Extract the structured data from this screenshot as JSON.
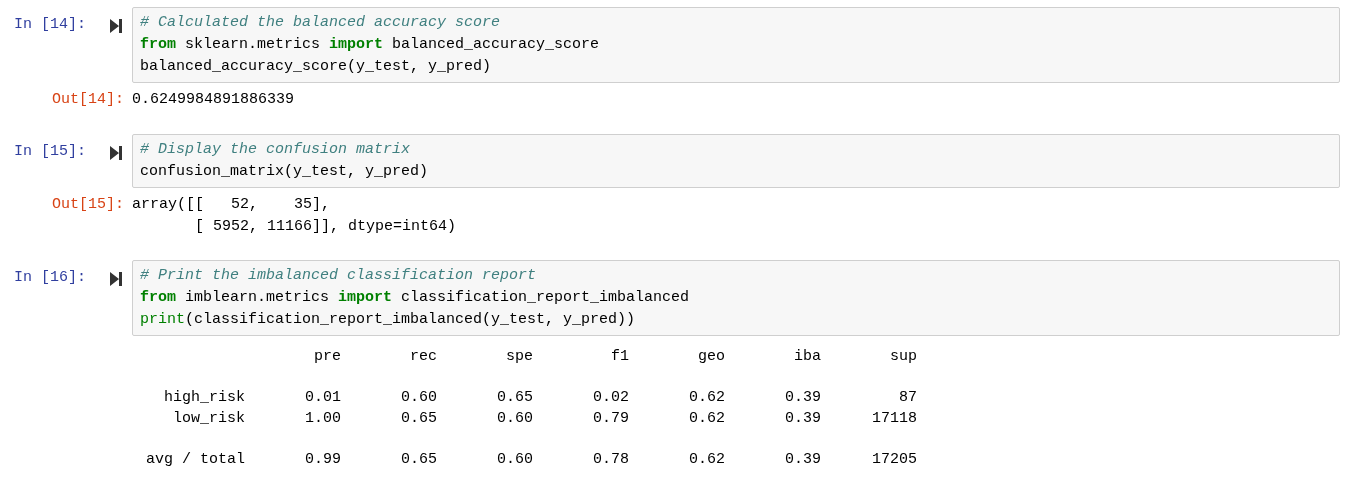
{
  "cells": [
    {
      "prompt": "In [14]:",
      "code": [
        [
          {
            "kind": "comment",
            "text": "# Calculated the balanced accuracy score"
          }
        ],
        [
          {
            "kind": "keyword",
            "text": "from"
          },
          {
            "kind": "plain",
            "text": " sklearn.metrics "
          },
          {
            "kind": "keyword",
            "text": "import"
          },
          {
            "kind": "plain",
            "text": " balanced_accuracy_score"
          }
        ],
        [
          {
            "kind": "plain",
            "text": "balanced_accuracy_score(y_test, y_pred)"
          }
        ]
      ],
      "output": {
        "kind": "text",
        "prompt": "Out[14]:",
        "lines": [
          "0.6249984891886339"
        ]
      }
    },
    {
      "prompt": "In [15]:",
      "code": [
        [
          {
            "kind": "comment",
            "text": "# Display the confusion matrix"
          }
        ],
        [
          {
            "kind": "plain",
            "text": "confusion_matrix(y_test, y_pred)"
          }
        ]
      ],
      "output": {
        "kind": "text",
        "prompt": "Out[15]:",
        "lines": [
          "array([[   52,    35],",
          "       [ 5952, 11166]], dtype=int64)"
        ]
      }
    },
    {
      "prompt": "In [16]:",
      "code": [
        [
          {
            "kind": "comment",
            "text": "# Print the imbalanced classification report"
          }
        ],
        [
          {
            "kind": "keyword",
            "text": "from"
          },
          {
            "kind": "plain",
            "text": " imblearn.metrics "
          },
          {
            "kind": "keyword",
            "text": "import"
          },
          {
            "kind": "plain",
            "text": " classification_report_imbalanced"
          }
        ],
        [
          {
            "kind": "builtin",
            "text": "print"
          },
          {
            "kind": "plain",
            "text": "(classification_report_imbalanced(y_test, y_pred))"
          }
        ]
      ],
      "output": {
        "kind": "report",
        "columns": [
          "pre",
          "rec",
          "spe",
          "f1",
          "geo",
          "iba",
          "sup"
        ],
        "groups": [
          [
            {
              "label": "high_risk",
              "values": [
                "0.01",
                "0.60",
                "0.65",
                "0.02",
                "0.62",
                "0.39",
                "87"
              ]
            },
            {
              "label": "low_risk",
              "values": [
                "1.00",
                "0.65",
                "0.60",
                "0.79",
                "0.62",
                "0.39",
                "17118"
              ]
            }
          ],
          [
            {
              "label": "avg / total",
              "values": [
                "0.99",
                "0.65",
                "0.60",
                "0.78",
                "0.62",
                "0.39",
                "17205"
              ]
            }
          ]
        ]
      }
    }
  ]
}
